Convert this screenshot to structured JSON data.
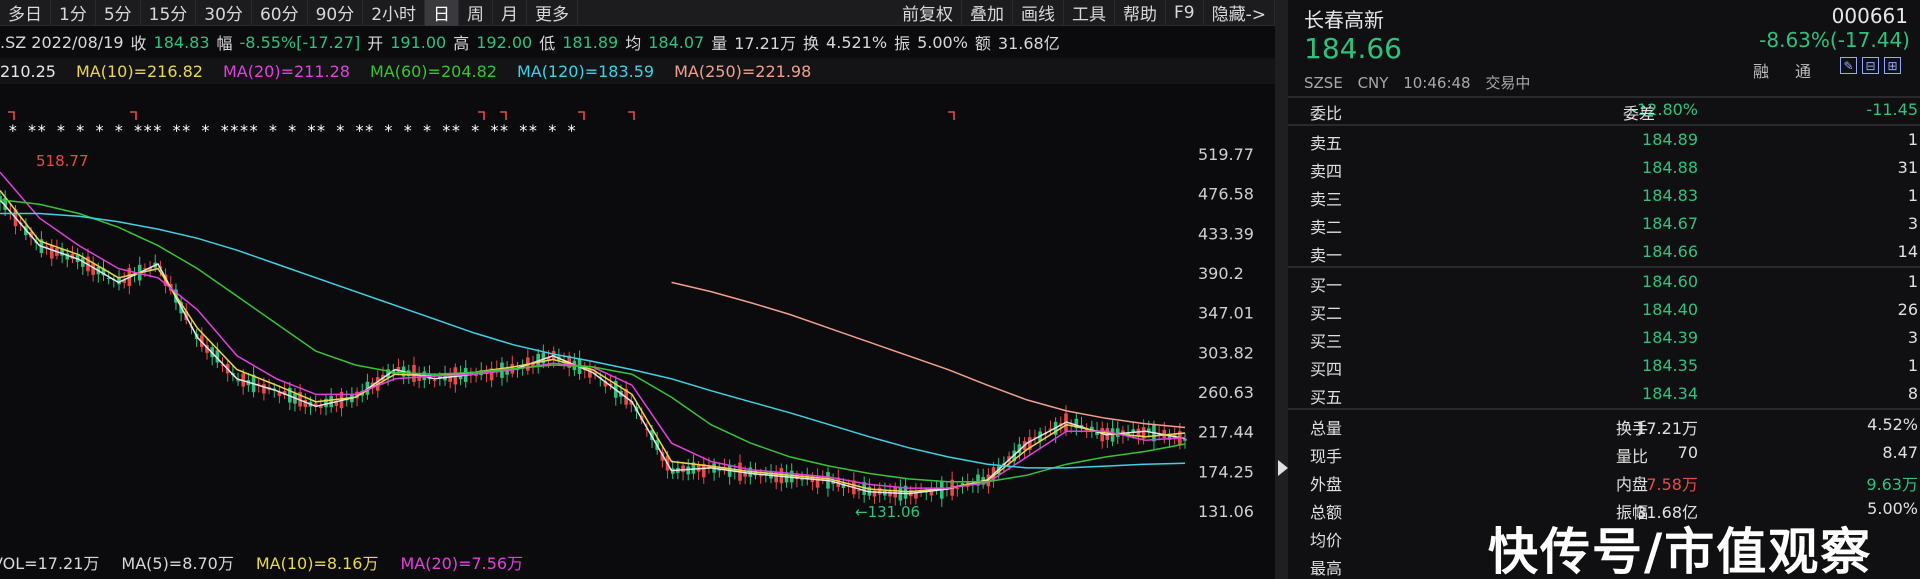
{
  "toolbar": {
    "left": [
      "多日",
      "1分",
      "5分",
      "15分",
      "30分",
      "60分",
      "90分",
      "2小时",
      "日",
      "周",
      "月",
      "更多"
    ],
    "active": "日",
    "right": [
      "前复权",
      "叠加",
      "画线",
      "工具",
      "帮助",
      "F9",
      "隐藏->"
    ]
  },
  "info": {
    "code_date": ".SZ 2022/08/19",
    "close_label": "收",
    "close_value": "184.83",
    "range_label": "幅",
    "range_value": "-8.55%[-17.27]",
    "open_label": "开",
    "open_value": "191.00",
    "high_label": "高",
    "high_value": "192.00",
    "low_label": "低",
    "low_value": "181.89",
    "avg_label": "均",
    "avg_value": "184.07",
    "vol_label": "量",
    "vol_value": "17.21万",
    "turn_label": "换",
    "turn_value": "4.521%",
    "amp_label": "振",
    "amp_value": "5.00%",
    "amt_label": "额",
    "amt_value": "31.68亿"
  },
  "ma": {
    "ma5": "210.25",
    "ma10": "MA(10)=216.82",
    "ma20": "MA(20)=211.28",
    "ma60": "MA(60)=204.82",
    "ma120": "MA(120)=183.59",
    "ma250": "MA(250)=221.98"
  },
  "colors": {
    "up": "#e84a4a",
    "down": "#2ec27e",
    "ma5": "#e8e8e8",
    "ma10": "#e9d94a",
    "ma20": "#e040e0",
    "ma60": "#36c436",
    "ma120": "#3ed2e6",
    "ma250": "#f0a08c"
  },
  "chart_data": {
    "type": "line",
    "y_ticks": [
      "519.77",
      "476.58",
      "433.39",
      "390.2",
      "347.01",
      "303.82",
      "260.63",
      "217.44",
      "174.25",
      "131.06"
    ],
    "ylim": [
      131.06,
      519.77
    ],
    "high_label": "518.77",
    "low_label": "←131.06",
    "x": [
      0,
      10,
      20,
      30,
      40,
      50,
      60,
      70,
      80,
      90,
      100,
      110,
      120,
      130,
      140,
      150,
      160,
      170,
      180,
      190,
      200,
      210,
      220,
      230,
      240,
      250,
      260,
      270,
      280,
      290,
      300
    ],
    "series": [
      {
        "name": "MA(5)",
        "color": "#e8e8e8",
        "values": [
          470,
          420,
          405,
          380,
          400,
          320,
          275,
          262,
          245,
          255,
          285,
          275,
          280,
          285,
          300,
          282,
          250,
          175,
          178,
          172,
          168,
          164,
          152,
          150,
          155,
          165,
          205,
          228,
          214,
          218,
          210
        ]
      },
      {
        "name": "MA(10)",
        "color": "#e9d94a",
        "values": [
          480,
          425,
          410,
          385,
          395,
          330,
          285,
          268,
          250,
          255,
          280,
          278,
          282,
          288,
          296,
          285,
          258,
          185,
          180,
          174,
          170,
          166,
          155,
          152,
          156,
          164,
          198,
          225,
          216,
          212,
          216
        ]
      },
      {
        "name": "MA(20)",
        "color": "#e040e0",
        "values": [
          500,
          450,
          420,
          395,
          385,
          350,
          300,
          275,
          258,
          258,
          275,
          278,
          280,
          285,
          292,
          288,
          268,
          205,
          185,
          176,
          172,
          168,
          160,
          156,
          156,
          162,
          190,
          218,
          218,
          208,
          211
        ]
      },
      {
        "name": "MA(60)",
        "color": "#36c436",
        "values": [
          470,
          465,
          455,
          440,
          420,
          395,
          365,
          335,
          305,
          290,
          282,
          280,
          282,
          286,
          290,
          288,
          280,
          255,
          225,
          205,
          190,
          180,
          172,
          166,
          163,
          163,
          170,
          182,
          190,
          196,
          204
        ]
      },
      {
        "name": "MA(120)",
        "color": "#3ed2e6",
        "values": [
          455,
          455,
          452,
          446,
          438,
          428,
          415,
          400,
          385,
          370,
          355,
          340,
          325,
          312,
          302,
          294,
          285,
          275,
          262,
          250,
          238,
          225,
          212,
          200,
          190,
          182,
          178,
          178,
          180,
          182,
          183
        ]
      },
      {
        "name": "MA(250)",
        "color": "#f0a08c",
        "values": [
          null,
          null,
          null,
          null,
          null,
          null,
          null,
          null,
          null,
          null,
          null,
          null,
          null,
          null,
          null,
          null,
          null,
          380,
          370,
          358,
          345,
          330,
          315,
          300,
          285,
          268,
          252,
          240,
          232,
          226,
          222
        ]
      }
    ],
    "signal_stars": "*  ** *    *    *    *  ***   **   *  ****  *   *  **  *  **     *     *     *   **      *          **   **   *  *"
  },
  "volume": {
    "vol": "VOL=17.21万",
    "ma5": "MA(5)=8.70万",
    "ma10": "MA(10)=8.16万",
    "ma20": "MA(20)=7.56万"
  },
  "quote": {
    "name": "长春高新",
    "code": "000661",
    "price": "184.66",
    "change": "-8.63%(-17.44)",
    "rong": "融",
    "tong": "通",
    "exchange": "SZSE",
    "currency": "CNY",
    "time": "10:46:48",
    "status": "交易中",
    "webi_label": "委比",
    "webi_value": "-12.80%",
    "wecha_label": "委差",
    "wecha_value": "-11.45",
    "asks": [
      {
        "label": "卖五",
        "price": "184.89",
        "vol": "1"
      },
      {
        "label": "卖四",
        "price": "184.88",
        "vol": "31"
      },
      {
        "label": "卖三",
        "price": "184.83",
        "vol": "1"
      },
      {
        "label": "卖二",
        "price": "184.67",
        "vol": "3"
      },
      {
        "label": "卖一",
        "price": "184.66",
        "vol": "14"
      }
    ],
    "bids": [
      {
        "label": "买一",
        "price": "184.60",
        "vol": "1"
      },
      {
        "label": "买二",
        "price": "184.40",
        "vol": "26"
      },
      {
        "label": "买三",
        "price": "184.39",
        "vol": "3"
      },
      {
        "label": "买四",
        "price": "184.35",
        "vol": "1"
      },
      {
        "label": "买五",
        "price": "184.34",
        "vol": "8"
      }
    ],
    "stats": [
      {
        "l1": "总量",
        "v1": "17.21万",
        "l2": "换手",
        "v2": "4.52%"
      },
      {
        "l1": "现手",
        "v1": "70",
        "l2": "量比",
        "v2": "8.47"
      },
      {
        "l1": "外盘",
        "v1": "7.58万",
        "l2": "内盘",
        "v2": "9.63万"
      },
      {
        "l1": "总额",
        "v1": "31.68亿",
        "l2": "振幅",
        "v2": "5.00%"
      },
      {
        "l1": "均价",
        "v1": "",
        "l2": "",
        "v2": ""
      },
      {
        "l1": "最高",
        "v1": "",
        "l2": "",
        "v2": ""
      }
    ]
  },
  "watermark": "快传号/市值观察"
}
